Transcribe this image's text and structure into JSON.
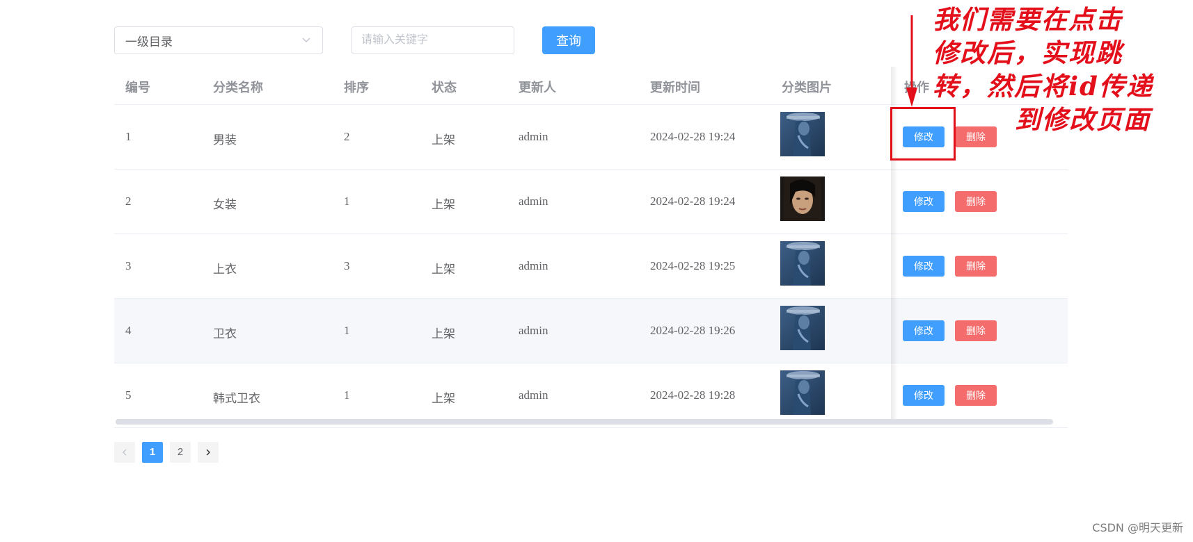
{
  "filter": {
    "select_value": "一级目录",
    "search_placeholder": "请输入关键字",
    "search_value": "",
    "query_label": "查询"
  },
  "table": {
    "headers": [
      "编号",
      "分类名称",
      "排序",
      "状态",
      "更新人",
      "更新时间",
      "分类图片",
      "操作"
    ],
    "rows": [
      {
        "id": "1",
        "name": "男装",
        "sort": "2",
        "status": "上架",
        "updater": "admin",
        "time": "2024-02-28 19:24",
        "image": "blue-figure"
      },
      {
        "id": "2",
        "name": "女装",
        "sort": "1",
        "status": "上架",
        "updater": "admin",
        "time": "2024-02-28 19:24",
        "image": "dark-portrait"
      },
      {
        "id": "3",
        "name": "上衣",
        "sort": "3",
        "status": "上架",
        "updater": "admin",
        "time": "2024-02-28 19:25",
        "image": "blue-figure"
      },
      {
        "id": "4",
        "name": "卫衣",
        "sort": "1",
        "status": "上架",
        "updater": "admin",
        "time": "2024-02-28 19:26",
        "image": "blue-figure"
      },
      {
        "id": "5",
        "name": "韩式卫衣",
        "sort": "1",
        "status": "上架",
        "updater": "admin",
        "time": "2024-02-28 19:28",
        "image": "blue-figure"
      }
    ],
    "edit_label": "修改",
    "delete_label": "删除",
    "hover_row_index": 3
  },
  "pagination": {
    "prev_icon": "chevron-left-icon",
    "next_icon": "chevron-right-icon",
    "pages": [
      "1",
      "2"
    ],
    "current": "1"
  },
  "annotation": {
    "lines": [
      "我们需要在点击",
      "修改后，实现跳",
      "转，然后将id传递",
      "到修改页面"
    ],
    "color": "#e3101b"
  },
  "watermark": "CSDN @明天更新",
  "colors": {
    "primary": "#409eff",
    "danger": "#f56c6c"
  }
}
